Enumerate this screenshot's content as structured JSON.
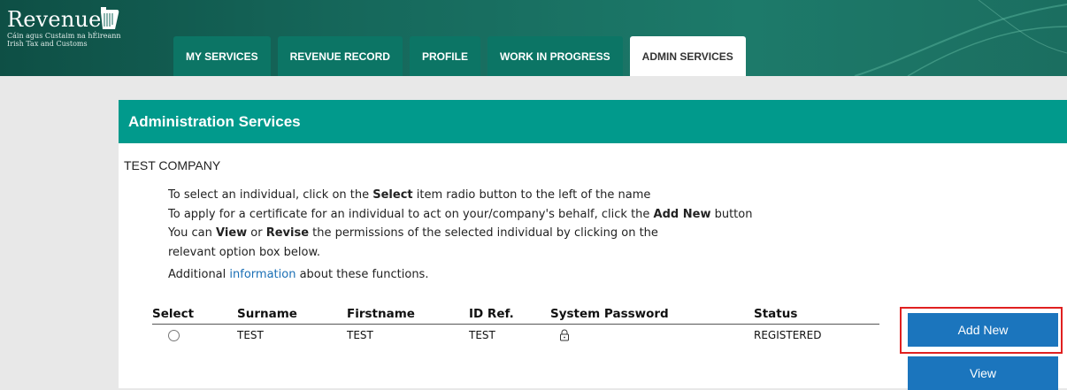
{
  "header": {
    "logo_word": "Revenue",
    "logo_line1": "Cáin agus Custaim na hÉireann",
    "logo_line2": "Irish Tax and Customs",
    "tabs": [
      {
        "label": "MY SERVICES"
      },
      {
        "label": "REVENUE RECORD"
      },
      {
        "label": "PROFILE"
      },
      {
        "label": "WORK IN PROGRESS"
      },
      {
        "label": "ADMIN SERVICES"
      }
    ],
    "active_tab": "ADMIN SERVICES"
  },
  "panel": {
    "title": "Administration Services",
    "company": "TEST COMPANY",
    "instructions": {
      "l1_a": "To select an individual, click on the ",
      "l1_b": "Select",
      "l1_c": " item radio button to the left of the name",
      "l2_a": "To apply for a certificate for an individual to act on your/company's behalf, click the ",
      "l2_b": "Add New",
      "l2_c": " button",
      "l3_a": "You can ",
      "l3_b": "View",
      "l3_c": " or ",
      "l3_d": "Revise",
      "l3_e": " the permissions of the selected individual by clicking on the",
      "l4": "relevant option box below.",
      "l5_a": "Additional ",
      "l5_link": "information",
      "l5_c": " about these functions."
    },
    "table": {
      "headers": [
        "Select",
        "Surname",
        "Firstname",
        "ID Ref.",
        "System Password",
        "Status"
      ],
      "rows": [
        {
          "surname": "TEST",
          "firstname": "TEST",
          "id_ref": "TEST",
          "password_icon": "lock-icon",
          "status": "REGISTERED"
        }
      ]
    },
    "buttons": {
      "add_new": "Add New",
      "view": "View"
    }
  },
  "colors": {
    "header_green": "#16695c",
    "tab_green": "#0c7565",
    "panel_teal": "#019a8c",
    "button_blue": "#1b75bd",
    "link_blue": "#1a6fb5",
    "highlight_red": "#e02020"
  }
}
